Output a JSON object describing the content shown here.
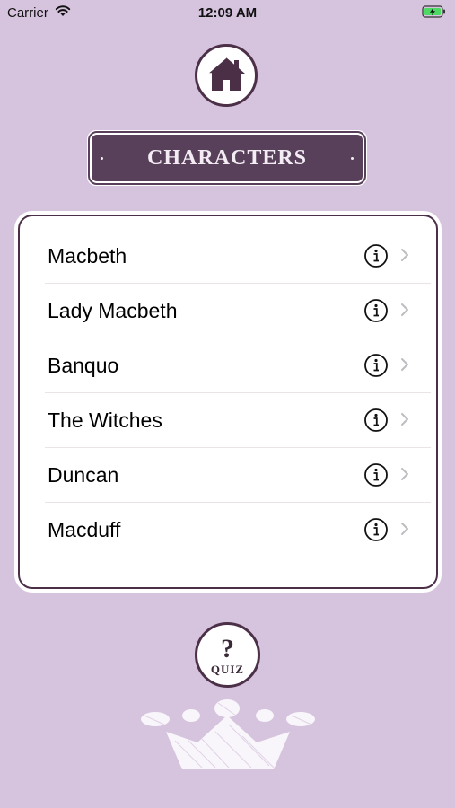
{
  "status_bar": {
    "carrier": "Carrier",
    "time": "12:09 AM"
  },
  "header": {
    "home_icon": "home-icon",
    "title": "CHARACTERS"
  },
  "characters": [
    {
      "name": "Macbeth"
    },
    {
      "name": "Lady Macbeth"
    },
    {
      "name": "Banquo"
    },
    {
      "name": "The Witches"
    },
    {
      "name": "Duncan"
    },
    {
      "name": "Macduff"
    }
  ],
  "quiz": {
    "mark": "?",
    "label": "QUIZ"
  },
  "colors": {
    "background": "#d6c3de",
    "accent": "#58405a",
    "border": "#4b3048",
    "card": "#ffffff"
  }
}
